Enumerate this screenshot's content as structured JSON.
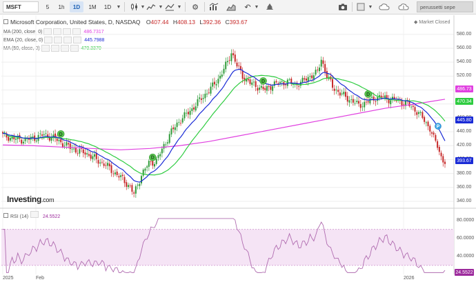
{
  "toolbar": {
    "symbol": "MSFT",
    "intervals": [
      "5",
      "1h",
      "1D",
      "1M",
      "1D"
    ],
    "active_interval_index": 2,
    "user": "perussetti sepe"
  },
  "chart_header": {
    "title": "Microsoft Corporation, United States, D, NASDAQ",
    "open_label": "O",
    "open": "407.44",
    "high_label": "H",
    "high": "408.13",
    "low_label": "L",
    "low": "392.36",
    "close_label": "C",
    "close": "393.67",
    "market_status": "Market Closed"
  },
  "indicators": [
    {
      "name": "MA (200, close, 0)",
      "value": "486.7317",
      "color": "#e040e0"
    },
    {
      "name": "EMA (20, close, 0)",
      "value": "445.7988",
      "color": "#1a2bd6"
    },
    {
      "name": "MA (50, close, 0)",
      "value": "470.3370",
      "color": "#2ecc40"
    }
  ],
  "price_axis": [
    "580.00",
    "560.00",
    "540.00",
    "520.00",
    "500.00",
    "480.00",
    "460.00",
    "440.00",
    "420.00",
    "400.00",
    "380.00",
    "360.00",
    "340.00"
  ],
  "price_tags": [
    {
      "label": "486.73",
      "color": "#e040e0"
    },
    {
      "label": "470.34",
      "color": "#2ecc40"
    },
    {
      "label": "445.80",
      "color": "#1a2bd6"
    },
    {
      "label": "393.67",
      "color": "#1a2bd6"
    }
  ],
  "rsi": {
    "title": "RSI (14)",
    "value": "24.5522",
    "axis": [
      "80.0000",
      "60.0000",
      "40.0000",
      "20.0000"
    ],
    "tag": "24.5522"
  },
  "x_axis": [
    "2025",
    "Feb",
    "2026"
  ],
  "events": [
    "D",
    "D",
    "D",
    "D",
    "D"
  ],
  "future_marker": "P",
  "logo": {
    "brand": "Investing",
    "suffix": ".com"
  },
  "colors": {
    "up": "#2e9a38",
    "down": "#c62828",
    "ma200": "#e040e0",
    "ema20": "#1a2bd6",
    "ma50": "#2ecc40",
    "rsi": "#b06cb0",
    "rsi_band": "#f5e4f5"
  },
  "chart_data": {
    "type": "line",
    "title": "Microsoft Corporation, United States, D, NASDAQ",
    "ylim": [
      340,
      580
    ],
    "series": [
      {
        "name": "MA (200, close, 0)",
        "values": [
          421,
          420,
          418,
          416,
          414,
          416,
          420,
          426,
          434,
          442,
          450,
          458,
          466,
          474,
          480,
          486.73
        ]
      },
      {
        "name": "EMA (20, close, 0)",
        "values": [
          432,
          425,
          415,
          400,
          388,
          386,
          415,
          460,
          500,
          515,
          512,
          505,
          494,
          488,
          475,
          445.8
        ]
      },
      {
        "name": "MA (50, close, 0)",
        "values": [
          430,
          428,
          420,
          408,
          398,
          390,
          400,
          430,
          470,
          500,
          512,
          510,
          500,
          490,
          482,
          470.34
        ]
      }
    ],
    "last_close": 393.67,
    "rsi_ylim": [
      20,
      85
    ]
  }
}
